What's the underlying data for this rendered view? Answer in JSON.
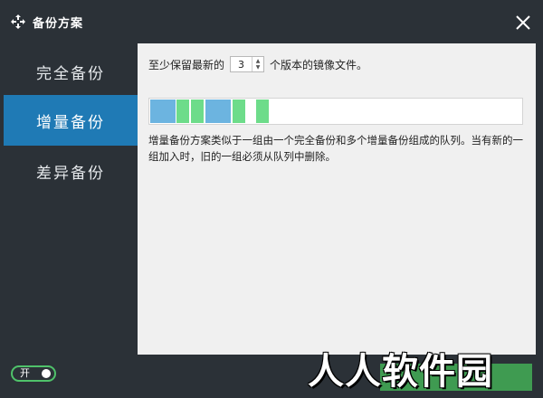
{
  "window": {
    "title": "备份方案",
    "app_icon": "sync-arrows-icon",
    "close_icon": "close-icon"
  },
  "sidebar": {
    "items": [
      {
        "label": "完全备份",
        "active": false
      },
      {
        "label": "增量备份",
        "active": true
      },
      {
        "label": "差异备份",
        "active": false
      }
    ]
  },
  "main": {
    "retain_prefix": "至少保留最新的",
    "retain_value": "3",
    "retain_suffix": "个版本的镜像文件。",
    "description": "增量备份方案类似于一组由一个完全备份和多个增量备份组成的队列。当有新的一组加入时，旧的一组必须从队列中删除。",
    "segments": [
      {
        "kind": "full",
        "color": "#6cb4e0"
      },
      {
        "kind": "incremental",
        "color": "#6ddc8a"
      },
      {
        "kind": "incremental",
        "color": "#6ddc8a"
      },
      {
        "kind": "full",
        "color": "#6cb4e0"
      },
      {
        "kind": "incremental",
        "color": "#6ddc8a"
      },
      {
        "kind": "incremental",
        "color": "#6ddc8a"
      }
    ]
  },
  "footer": {
    "toggle_label": "开",
    "toggle_on": true
  },
  "watermark": "人人软件园",
  "colors": {
    "accent": "#1f7ab5",
    "background": "#2b3137",
    "full_backup": "#6cb4e0",
    "incremental_backup": "#6ddc8a",
    "toggle": "#4fc26a"
  }
}
